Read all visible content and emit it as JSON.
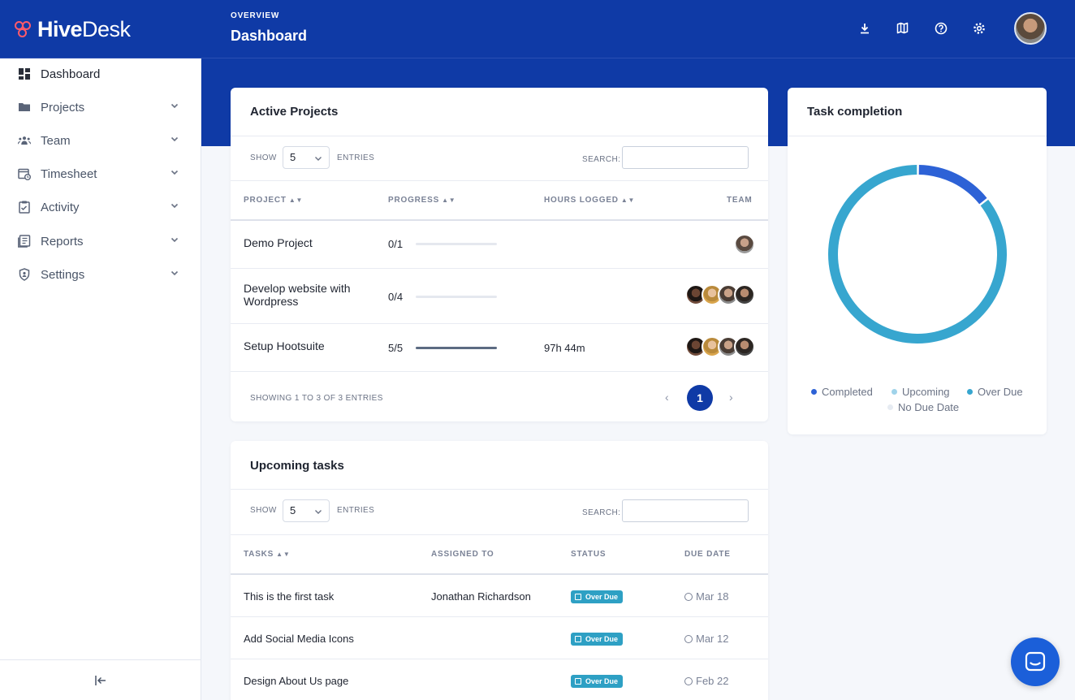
{
  "brand": {
    "name_bold": "Hive",
    "name_light": "Desk",
    "accent": "#ff5a6a",
    "primary": "#0f3aa6"
  },
  "header": {
    "overline": "OVERVIEW",
    "title": "Dashboard",
    "icons": [
      "download-icon",
      "map-icon",
      "help-icon",
      "settings-icon"
    ]
  },
  "sidebar": {
    "items": [
      {
        "label": "Dashboard",
        "icon": "dashboard-icon"
      },
      {
        "label": "Projects",
        "icon": "folder-icon"
      },
      {
        "label": "Team",
        "icon": "team-icon"
      },
      {
        "label": "Timesheet",
        "icon": "timesheet-icon"
      },
      {
        "label": "Activity",
        "icon": "activity-icon"
      },
      {
        "label": "Reports",
        "icon": "reports-icon"
      },
      {
        "label": "Settings",
        "icon": "shield-icon"
      }
    ]
  },
  "active_projects": {
    "title": "Active Projects",
    "show_label": "SHOW",
    "entries_label": "ENTRIES",
    "page_size": "5",
    "search_label": "SEARCH:",
    "columns": [
      "PROJECT",
      "PROGRESS",
      "HOURS LOGGED",
      "TEAM"
    ],
    "rows": [
      {
        "project": "Demo Project",
        "progress": "0/1",
        "fraction": 0,
        "hours": "",
        "team_size": 1
      },
      {
        "project": "Develop website with Wordpress",
        "progress": "0/4",
        "fraction": 0,
        "hours": "",
        "team_size": 4
      },
      {
        "project": "Setup Hootsuite",
        "progress": "5/5",
        "fraction": 1,
        "hours": "97h 44m",
        "team_size": 4
      }
    ],
    "footer": "SHOWING 1 TO 3 OF 3 ENTRIES",
    "current_page": "1",
    "prev": "‹",
    "next": "›"
  },
  "upcoming_tasks": {
    "title": "Upcoming tasks",
    "show_label": "SHOW",
    "entries_label": "ENTRIES",
    "page_size": "5",
    "search_label": "SEARCH:",
    "columns": [
      "TASKS",
      "ASSIGNED TO",
      "STATUS",
      "DUE DATE"
    ],
    "rows": [
      {
        "task": "This is the first task",
        "assigned": "Jonathan Richardson",
        "status": "Over Due",
        "due": "Mar 18"
      },
      {
        "task": "Add Social Media Icons",
        "assigned": "",
        "status": "Over Due",
        "due": "Mar 12"
      },
      {
        "task": "Design About Us page",
        "assigned": "",
        "status": "Over Due",
        "due": "Feb 22"
      }
    ]
  },
  "task_completion": {
    "title": "Task completion",
    "legend": [
      {
        "label": "Completed",
        "color": "#2d62d6"
      },
      {
        "label": "Upcoming",
        "color": "#9fd3ea"
      },
      {
        "label": "Over Due",
        "color": "#37a6cf"
      },
      {
        "label": "No Due Date",
        "color": "#e6ebf2"
      }
    ]
  },
  "chart_data": {
    "type": "pie",
    "title": "Task completion",
    "categories": [
      "Completed",
      "Upcoming",
      "Over Due",
      "No Due Date"
    ],
    "values": [
      5,
      0,
      30,
      0
    ],
    "donut": true,
    "legend": "bottom"
  }
}
